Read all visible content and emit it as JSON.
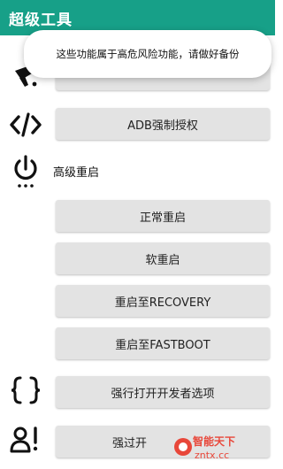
{
  "appbar": {
    "title": "超级工具"
  },
  "toast": {
    "message": "这些功能属于高危风险功能，请做好备份"
  },
  "buttons": {
    "adb_grant": "ADB强制授权",
    "normal_reboot": "正常重启",
    "soft_reboot": "软重启",
    "reboot_recovery": "重启至RECOVERY",
    "reboot_fastboot": "重启至FASTBOOT",
    "force_dev_options": "强行打开开发者选项",
    "force_bypass": "强过开"
  },
  "sections": {
    "advanced_reboot": "高级重启"
  },
  "watermark": {
    "line1": "智能天下",
    "line2": "zntx.cc"
  },
  "colors": {
    "appbar": "#17a088",
    "button_bg": "#e3e3e3"
  },
  "icons": [
    "broom-icon",
    "code-icon",
    "power-icon",
    "braces-icon",
    "user-alert-icon"
  ]
}
